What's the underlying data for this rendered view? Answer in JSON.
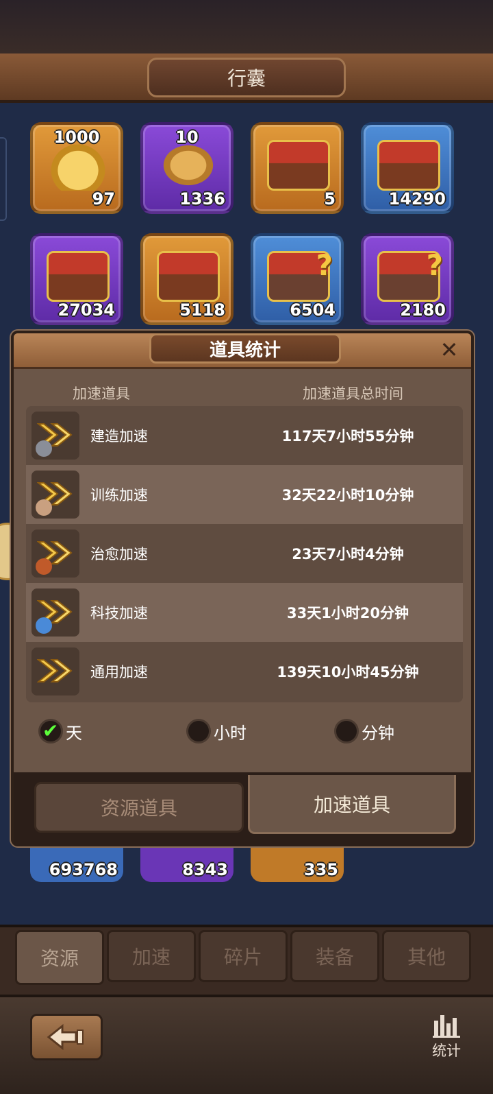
{
  "header": {
    "title": "行囊"
  },
  "items": [
    {
      "top": "1000",
      "count": "97",
      "pic": "gold-ingot-icon"
    },
    {
      "top": "10",
      "count": "1336",
      "pic": "wheat-icon"
    },
    {
      "top": "",
      "count": "5",
      "pic": "treasure-chest-icon"
    },
    {
      "top": "",
      "count": "14290",
      "pic": "resource-chest-icon"
    },
    {
      "top": "",
      "count": "27034",
      "pic": "resource-chest-icon"
    },
    {
      "top": "",
      "count": "5118",
      "pic": "resource-chest-icon"
    },
    {
      "top": "",
      "count": "6504",
      "pic": "mystery-chest-icon"
    },
    {
      "top": "",
      "count": "2180",
      "pic": "mystery-chest-icon"
    }
  ],
  "peek_items": [
    {
      "count": "693768"
    },
    {
      "count": "8343"
    },
    {
      "count": "335"
    }
  ],
  "dialog": {
    "title": "道具统计",
    "col_item": "加速道具",
    "col_time": "加速道具总时间",
    "rows": [
      {
        "name": "建造加速",
        "time": "117天7小时55分钟",
        "icon": "build-speedup-icon"
      },
      {
        "name": "训练加速",
        "time": "32天22小时10分钟",
        "icon": "training-speedup-icon"
      },
      {
        "name": "治愈加速",
        "time": "23天7小时4分钟",
        "icon": "healing-speedup-icon"
      },
      {
        "name": "科技加速",
        "time": "33天1小时20分钟",
        "icon": "research-speedup-icon"
      },
      {
        "name": "通用加速",
        "time": "139天10小时45分钟",
        "icon": "general-speedup-icon"
      }
    ],
    "units": [
      {
        "label": "天",
        "selected": true
      },
      {
        "label": "小时",
        "selected": false
      },
      {
        "label": "分钟",
        "selected": false
      }
    ],
    "tabs": {
      "resource": "资源道具",
      "speedup": "加速道具",
      "active": "speedup"
    }
  },
  "bottom_tabs": [
    "资源",
    "加速",
    "碎片",
    "装备",
    "其他"
  ],
  "bottom_active": "资源",
  "footer": {
    "stats_label": "统计"
  },
  "colors": {
    "check": "#5cff3a",
    "panel": "#6b5648",
    "accent": "#b98558"
  }
}
